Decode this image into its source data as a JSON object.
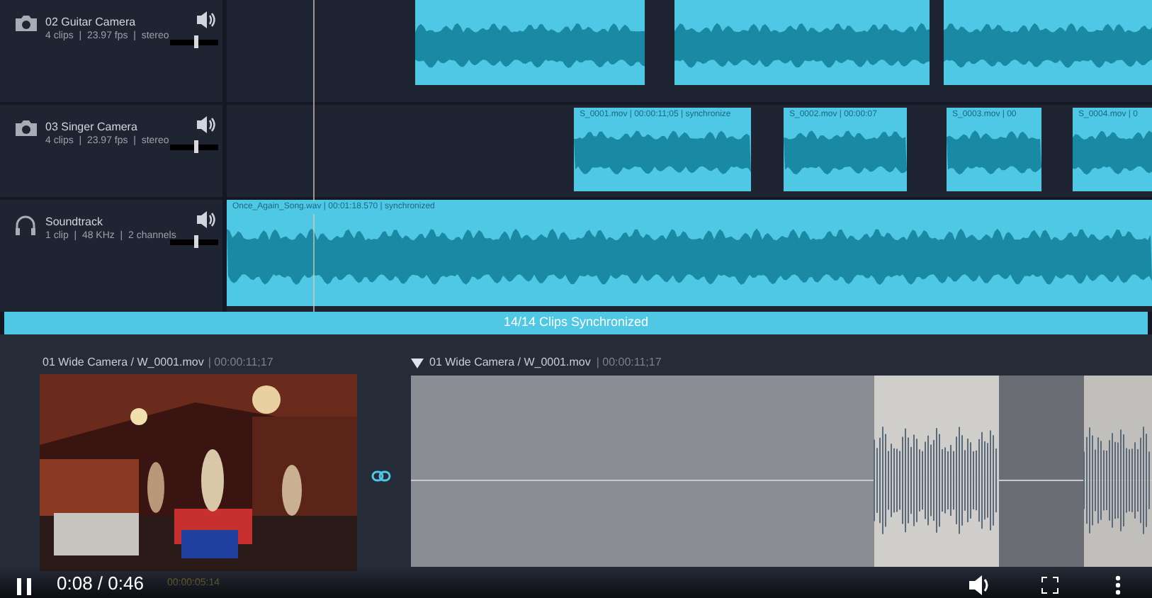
{
  "tracks": [
    {
      "kind": "camera",
      "name": "02 Guitar Camera",
      "info": "4 clips  |  23.97 fps  |  stereo",
      "volume": {
        "level": 0.55
      },
      "clips": [
        {
          "kind": "audio"
        },
        {
          "kind": "audio"
        },
        {
          "kind": "audio"
        }
      ]
    },
    {
      "kind": "camera",
      "name": "03 Singer Camera",
      "info": "4 clips  |  23.97 fps  |  stereo",
      "volume": {
        "level": 0.55
      },
      "clips": [
        {
          "kind": "audio",
          "label": "S_0001.mov | 00:00:11;05 | synchronize"
        },
        {
          "kind": "audio",
          "label": "S_0002.mov | 00:00:07"
        },
        {
          "kind": "audio",
          "label": "S_0003.mov | 00"
        },
        {
          "kind": "audio",
          "label": "S_0004.mov | 0"
        }
      ]
    },
    {
      "kind": "audio",
      "name": "Soundtrack",
      "info": "1 clip  |  48 KHz  |  2 channels",
      "volume": {
        "level": 0.55
      },
      "clips": [
        {
          "kind": "audio",
          "label": "Once_Again_Song.wav | 00:01:18.570 | synchronized"
        }
      ]
    }
  ],
  "sync_status": "14/14 Clips Synchronized",
  "preview": {
    "title": "01 Wide Camera / W_0001.mov",
    "timecode": "| 00:00:11;17",
    "position": "00:00:05:14"
  },
  "waveform_view": {
    "title": "01 Wide Camera / W_0001.mov",
    "timecode": "| 00:00:11;17",
    "expanded": true
  },
  "player": {
    "playing": true,
    "time": "0:08 / 0:46"
  }
}
